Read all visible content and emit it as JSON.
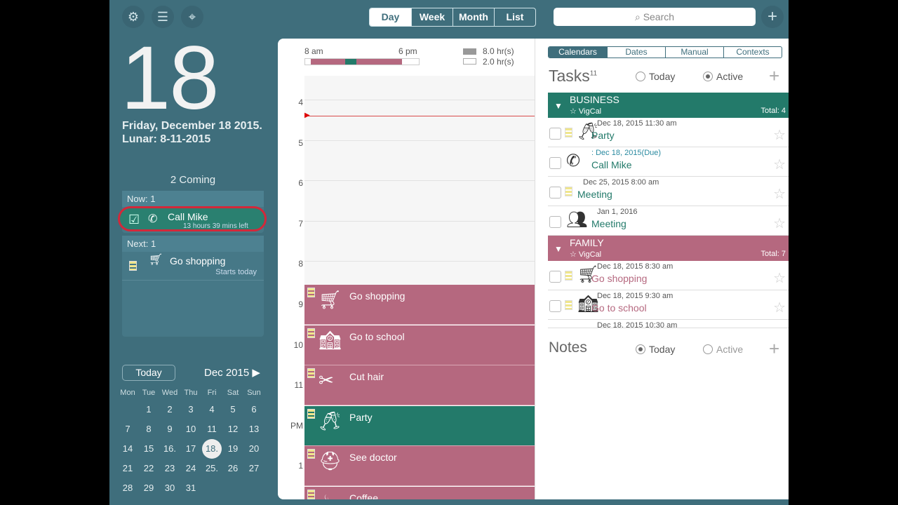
{
  "toolbar": {
    "views": [
      "Day",
      "Week",
      "Month",
      "List"
    ],
    "active_view": "Day",
    "search_placeholder": "Search"
  },
  "sidebar": {
    "day": "18",
    "date": "Friday, December 18 2015.",
    "lunar": "Lunar: 8-11-2015",
    "coming": "2 Coming",
    "now_label": "Now: 1",
    "now_item": {
      "title": "Call Mike",
      "sub": "13 hours 39 mins left"
    },
    "next_label": "Next: 1",
    "next_item": {
      "title": "Go shopping",
      "sub": "Starts today"
    },
    "today_button": "Today",
    "month": "Dec 2015",
    "weekdays": [
      "Mon",
      "Tue",
      "Wed",
      "Thu",
      "Fri",
      "Sat",
      "Sun"
    ],
    "days": [
      "",
      "1",
      "2",
      "3",
      "4",
      "5",
      "6",
      "7",
      "8",
      "9",
      "10",
      "11",
      "12",
      "13",
      "14",
      "15",
      "16.",
      "17",
      "18.",
      "19",
      "20",
      "21",
      "22",
      "23",
      "24",
      "25.",
      "26",
      "27",
      "28",
      "29",
      "30",
      "31"
    ],
    "selected_day": "18."
  },
  "day_view": {
    "range_start": "8 am",
    "range_end": "6 pm",
    "busy": "8.0 hr(s)",
    "free": "2.0 hr(s)",
    "hours": [
      "4",
      "5",
      "6",
      "7",
      "8",
      "9",
      "10",
      "11",
      "PM",
      "1"
    ],
    "events": [
      {
        "title": "Go shopping",
        "icon": "cart-icon",
        "color": "#b5687f"
      },
      {
        "title": "Go to school",
        "icon": "school-icon",
        "color": "#b5687f"
      },
      {
        "title": "Cut hair",
        "icon": "scissors-icon",
        "color": "#b5687f"
      },
      {
        "title": "Party",
        "icon": "champagne-icon",
        "color": "#237a6a"
      },
      {
        "title": "See doctor",
        "icon": "doctor-icon",
        "color": "#b5687f"
      },
      {
        "title": "Coffee",
        "icon": "coffee-icon",
        "color": "#b5687f"
      }
    ]
  },
  "tasks": {
    "tabs": [
      "Calendars",
      "Dates",
      "Manual",
      "Contexts"
    ],
    "title": "Tasks",
    "count": "11",
    "today": "Today",
    "active": "Active",
    "groups": [
      {
        "name": "BUSINESS",
        "source": "VigCal",
        "total": "Total: 4",
        "color": "#237a6a",
        "items": [
          {
            "date": "Dec 18, 2015  11:30 am",
            "title": "Party"
          },
          {
            "date": ": Dec 18, 2015(Due)",
            "title": "Call Mike"
          },
          {
            "date": "Dec 25, 2015  8:00 am",
            "title": "Meeting"
          },
          {
            "date": "Jan 1, 2016",
            "title": "Meeting"
          }
        ]
      },
      {
        "name": "FAMILY",
        "source": "VigCal",
        "total": "Total: 7",
        "color": "#b5687f",
        "items": [
          {
            "date": "Dec 18, 2015  8:30 am",
            "title": "Go shopping"
          },
          {
            "date": "Dec 18, 2015  9:30 am",
            "title": "Go to school"
          },
          {
            "date": "Dec 18, 2015  10:30 am",
            "title": ""
          }
        ]
      }
    ]
  },
  "notes": {
    "title": "Notes",
    "today": "Today",
    "active": "Active"
  }
}
